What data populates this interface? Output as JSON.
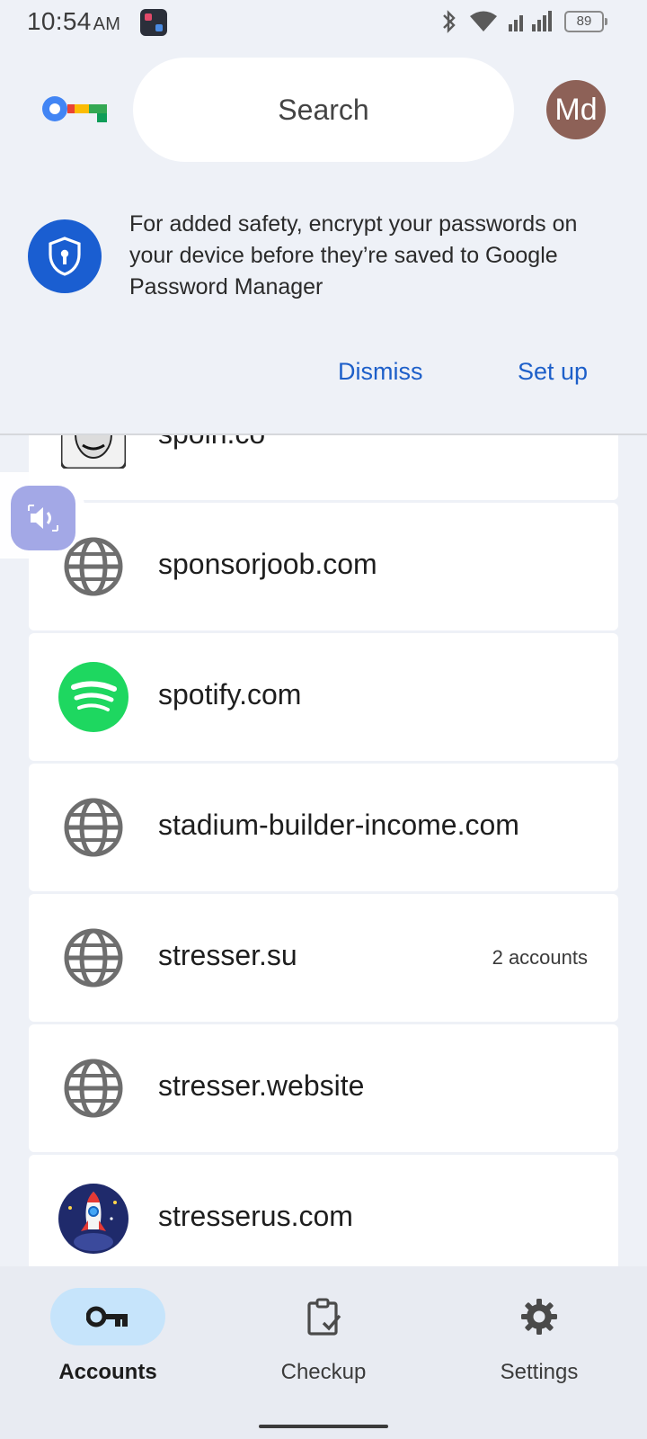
{
  "status_bar": {
    "time": "10:54",
    "ampm": "AM",
    "battery": "89"
  },
  "header": {
    "search_placeholder": "Search",
    "avatar_initials": "Md"
  },
  "banner": {
    "message": "For added safety, encrypt your passwords on your device before they’re saved to Google Password Manager",
    "dismiss_label": "Dismiss",
    "setup_label": "Set up"
  },
  "accounts": [
    {
      "site": "spoin.co",
      "icon": "mask-site-icon",
      "meta": ""
    },
    {
      "site": "sponsorjoob.com",
      "icon": "globe-icon",
      "meta": ""
    },
    {
      "site": "spotify.com",
      "icon": "spotify-icon",
      "meta": ""
    },
    {
      "site": "stadium-builder-income.com",
      "icon": "globe-icon",
      "meta": ""
    },
    {
      "site": "stresser.su",
      "icon": "globe-icon",
      "meta": "2 accounts"
    },
    {
      "site": "stresser.website",
      "icon": "globe-icon",
      "meta": ""
    },
    {
      "site": "stresserus.com",
      "icon": "rocket-site-icon",
      "meta": ""
    }
  ],
  "bottom_nav": {
    "items": [
      {
        "label": "Accounts",
        "icon": "key-icon",
        "active": true
      },
      {
        "label": "Checkup",
        "icon": "clipboard-check-icon",
        "active": false
      },
      {
        "label": "Settings",
        "icon": "gear-icon",
        "active": false
      }
    ]
  },
  "colors": {
    "accent": "#1d5fc9",
    "background": "#eef1f7",
    "nav_active": "#c6e4fb",
    "avatar": "#8d6157",
    "shield": "#1a5ed1"
  }
}
